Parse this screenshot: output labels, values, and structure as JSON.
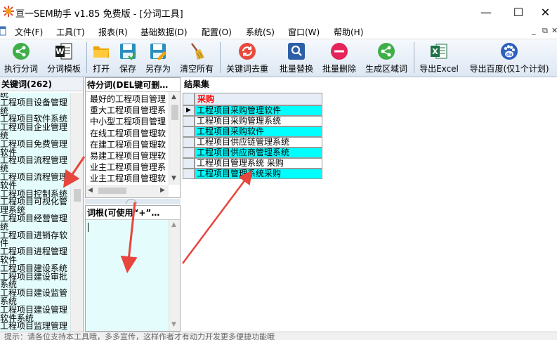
{
  "window": {
    "title": "亘一SEM助手 v1.85 免费版 - [分词工具]",
    "minimize_glyph": "—",
    "maximize_glyph": "☐",
    "close_glyph": "✕"
  },
  "menu": {
    "items": [
      "文件(F)",
      "工具(T)",
      "报表(R)",
      "基础数据(D)",
      "配置(O)",
      "系统(S)",
      "窗口(W)",
      "帮助(H)"
    ],
    "mdi_min": "_",
    "mdi_restore": "⧉",
    "mdi_close": "✕"
  },
  "toolbar": {
    "buttons": [
      {
        "label": "执行分词",
        "icon": "share-green-icon"
      },
      {
        "label": "分词模板",
        "icon": "word-document-icon"
      },
      {
        "label": "打开",
        "icon": "folder-open-icon"
      },
      {
        "label": "保存",
        "icon": "floppy-save-icon"
      },
      {
        "label": "另存为",
        "icon": "floppy-save-as-icon"
      },
      {
        "label": "清空所有",
        "icon": "broom-icon"
      },
      {
        "label": "关键词去重",
        "icon": "dedupe-red-icon"
      },
      {
        "label": "批量替换",
        "icon": "search-replace-icon"
      },
      {
        "label": "批量删除",
        "icon": "delete-red-icon"
      },
      {
        "label": "生成区域词",
        "icon": "share-green-icon"
      },
      {
        "label": "导出Excel",
        "icon": "excel-icon"
      },
      {
        "label": "导出百度(仅1个计划)",
        "icon": "baidu-paw-icon"
      }
    ]
  },
  "keywords_panel": {
    "title": "关键词(262)",
    "lines": [
      "统",
      "工程项目设备管理",
      "统",
      "工程项目软件系统",
      "工程项目企业管理",
      "统",
      "工程项目免费管理",
      "软件",
      "工程项目流程管理",
      "统",
      "工程项目流程管理",
      "软件",
      "工程项目控制系统",
      "工程项目可视化管",
      "理系统",
      "工程项目经营管理",
      "统",
      "工程项目进销存软",
      "件",
      "工程项目进程管理",
      "软件",
      "工程项目建设系统",
      "工程项目建设审批",
      "系统",
      "工程项目建设监管",
      "系统",
      "工程项目建设管理",
      "软件系统",
      "工程项目监理管理"
    ]
  },
  "pending_panel": {
    "title": "待分词(DEL键可删…",
    "rows": [
      "最好的工程项目管理",
      "重大工程项目管理系",
      "中小型工程项目管理",
      "在线工程项目管理软",
      "在建工程项目管理软",
      "易建工程项目管理软",
      "业主工程项目管理系",
      "业主工程项目管理软"
    ]
  },
  "root_panel": {
    "title": "词根(可使用“+”…",
    "content": ""
  },
  "result_panel": {
    "title": "结果集",
    "column_header": "采购",
    "rows": [
      {
        "text": "工程项目采购管理软件",
        "highlight": true,
        "current": true
      },
      {
        "text": "工程项目采购管理系统",
        "highlight": false,
        "current": false
      },
      {
        "text": "工程项目采购软件",
        "highlight": true,
        "current": false
      },
      {
        "text": "工程项目供应链管理系统",
        "highlight": false,
        "current": false
      },
      {
        "text": "工程项目供应商管理系统",
        "highlight": true,
        "current": false
      },
      {
        "text": "工程项目管理系统 采购",
        "highlight": false,
        "current": false
      },
      {
        "text": "工程项目管理系统采购",
        "highlight": true,
        "current": false
      }
    ]
  },
  "statusbar": {
    "text": "提示：请各位支持本工具哦，多多宣传，这样作者才有动力开发更多便捷功能哦"
  },
  "colors": {
    "highlight_row": "#00ffff",
    "header_red": "#ff0000",
    "annotation_arrow": "#e8453c"
  }
}
